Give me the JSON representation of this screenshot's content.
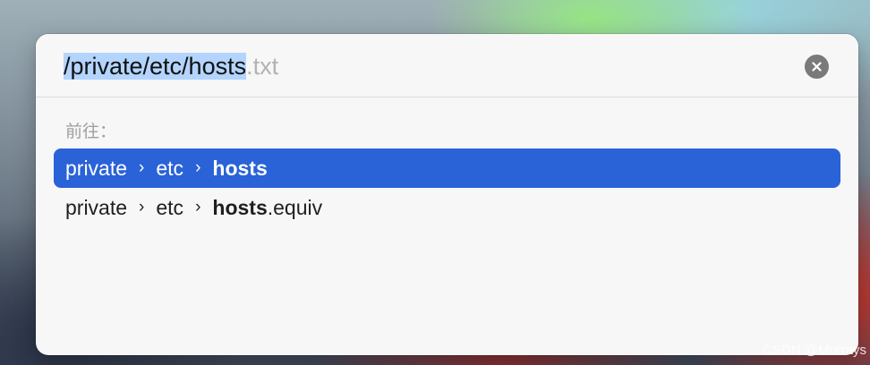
{
  "path_field": {
    "selected_text": "/private/etc/hosts",
    "autocomplete_suffix": ".txt"
  },
  "section_label": "前往：",
  "suggestions": [
    {
      "segments": [
        "private",
        "etc"
      ],
      "match": "hosts",
      "suffix": "",
      "selected": true
    },
    {
      "segments": [
        "private",
        "etc"
      ],
      "match": "hosts",
      "suffix": ".equiv",
      "selected": false
    }
  ],
  "separator_glyph": "›",
  "watermark": "CSDN @Murrays",
  "icons": {
    "clear": "close-circle-icon",
    "separator": "chevron-right-icon"
  },
  "colors": {
    "selection_highlight": "#2a62d8",
    "text_selection": "#b3d4fc"
  }
}
